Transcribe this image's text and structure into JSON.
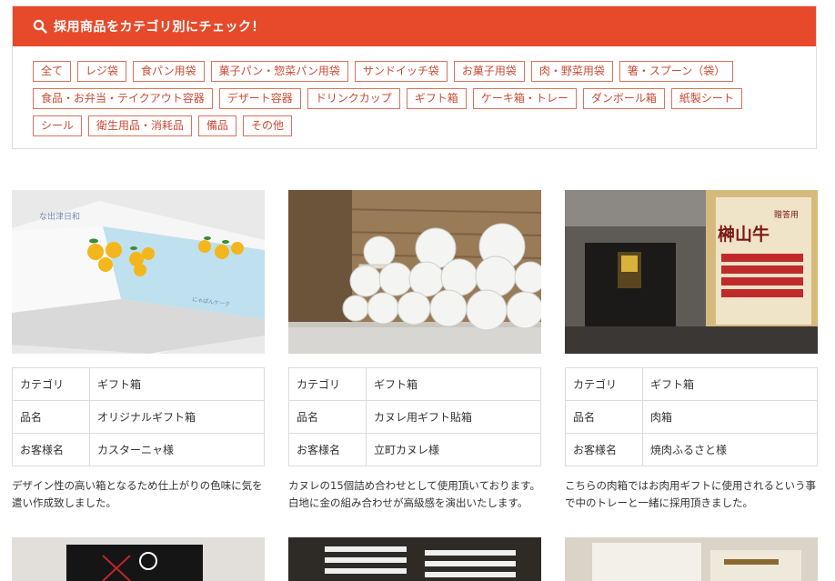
{
  "filter": {
    "title": "採用商品をカテゴリ別にチェック！",
    "rows": [
      [
        "全て",
        "レジ袋",
        "食パン用袋",
        "菓子パン・惣菜パン用袋",
        "サンドイッチ袋",
        "お菓子用袋",
        "肉・野菜用袋",
        "箸・スプーン（袋）"
      ],
      [
        "食品・お弁当・テイクアウト容器",
        "デザート容器",
        "ドリンクカップ",
        "ギフト箱",
        "ケーキ箱・トレー",
        "ダンボール箱",
        "紙製シート"
      ],
      [
        "シール",
        "衛生用品・消耗品",
        "備品",
        "その他"
      ]
    ]
  },
  "labels": {
    "category": "カテゴリ",
    "item": "品名",
    "customer": "お客様名"
  },
  "cards": [
    {
      "category": "ギフト箱",
      "item": "オリジナルギフト箱",
      "customer": "カスターニャ様",
      "desc_lines": [
        "デザイン性の高い箱となるため仕上がりの色味に気を",
        "遣い作成致しました。"
      ],
      "photo_text_1": "な出津日和",
      "photo_text_2": "にゃぱんケーク"
    },
    {
      "category": "ギフト箱",
      "item": "カヌレ用ギフト貼箱",
      "customer": "立町カヌレ様",
      "desc_lines": [
        "カヌレの15個詰め合わせとして使用頂いております。",
        "白地に金の組み合わせが高級感を演出いたします。"
      ]
    },
    {
      "category": "ギフト箱",
      "item": "肉箱",
      "customer": "焼肉ふるさと様",
      "desc_lines": [
        "こちらの肉箱ではお肉用ギフトに使用されるという事",
        "で中のトレーと一緒に採用頂きました。"
      ],
      "photo_text_1": "榊山牛",
      "photo_text_2": "贈答用"
    }
  ]
}
